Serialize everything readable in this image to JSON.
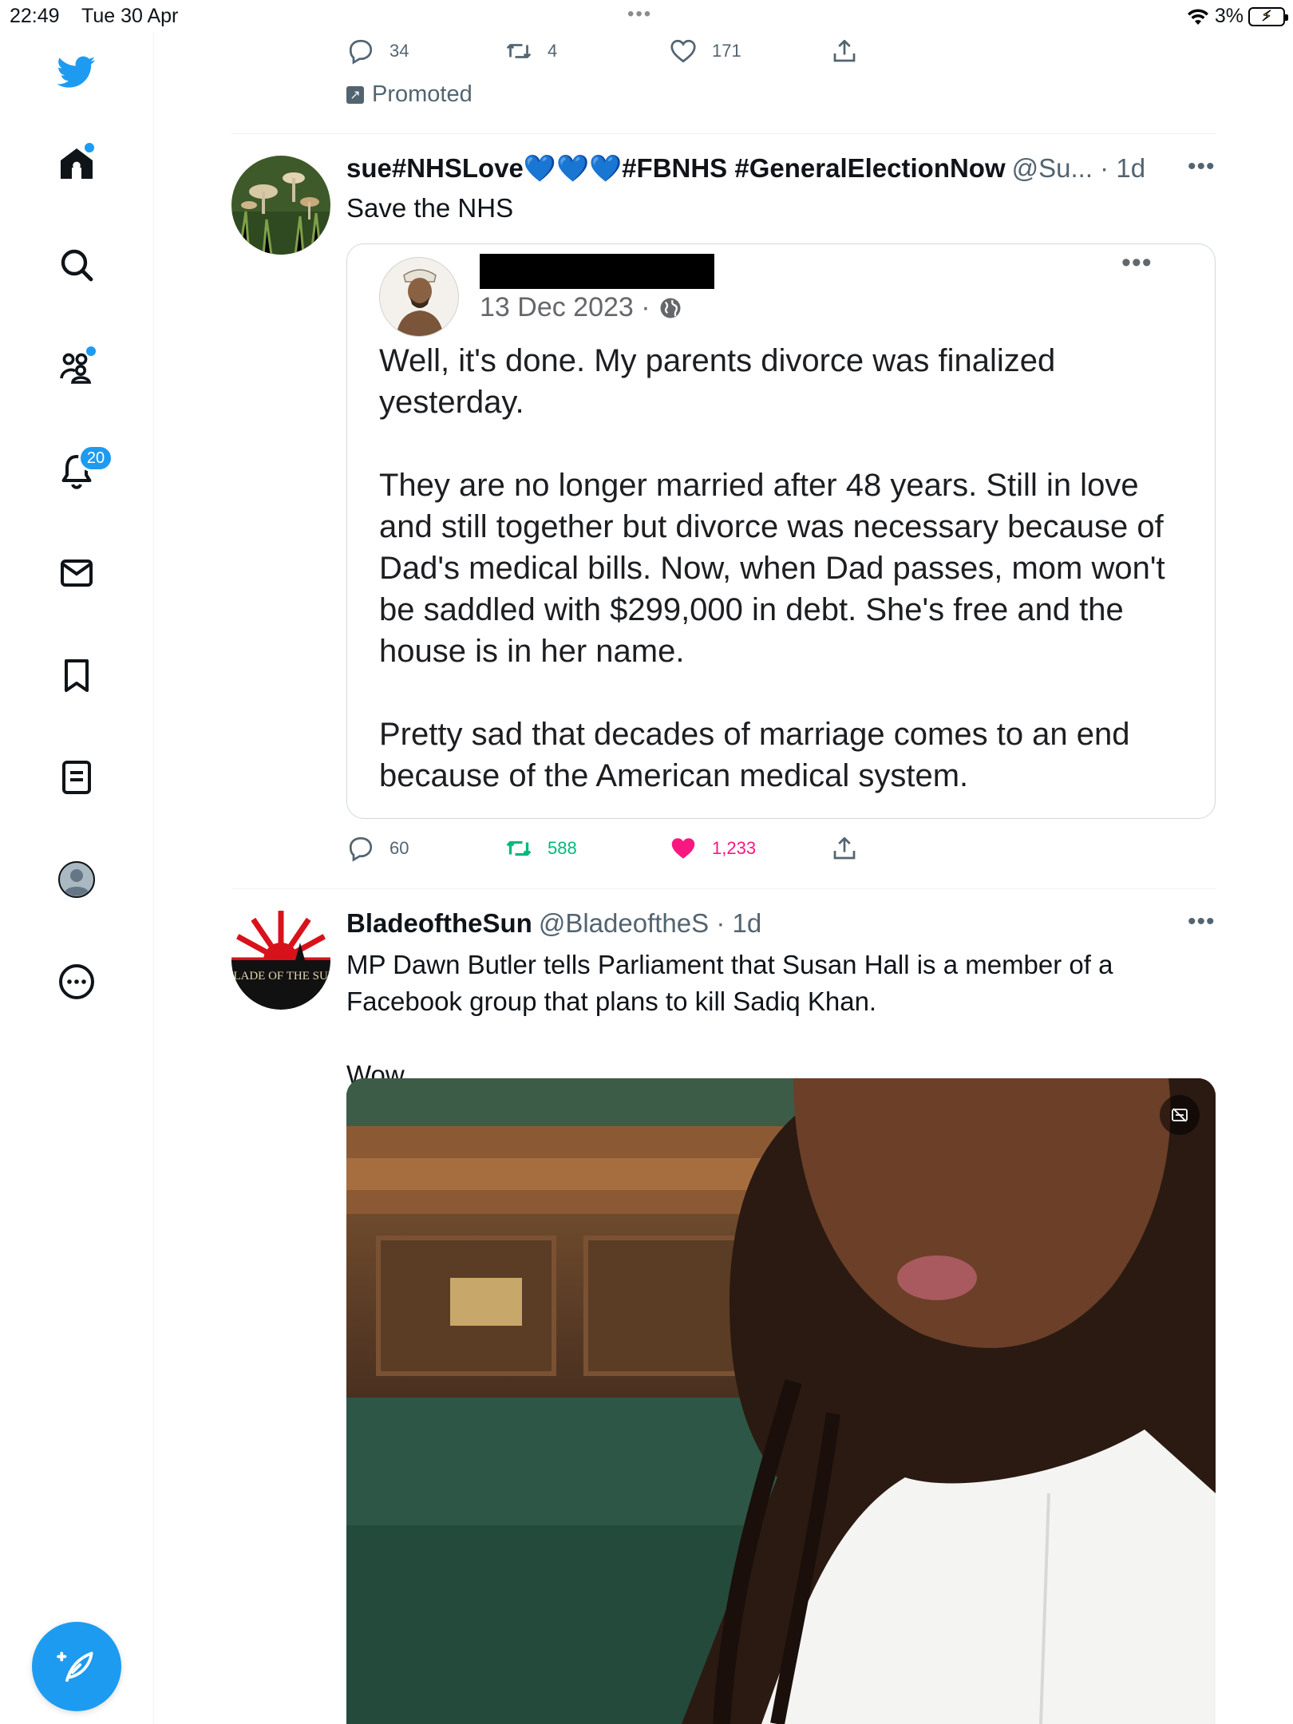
{
  "status_bar": {
    "time": "22:49",
    "date": "Tue 30 Apr",
    "battery_percent": "3%",
    "dots": "•••"
  },
  "sidebar": {
    "notifications_count": "20",
    "items": [
      {
        "name": "logo",
        "icon": "twitter-bird-icon"
      },
      {
        "name": "home",
        "icon": "home-icon",
        "has_dot": true
      },
      {
        "name": "explore",
        "icon": "search-icon"
      },
      {
        "name": "communities",
        "icon": "communities-icon",
        "has_dot": true
      },
      {
        "name": "notifications",
        "icon": "bell-icon"
      },
      {
        "name": "messages",
        "icon": "mail-icon"
      },
      {
        "name": "bookmarks",
        "icon": "bookmark-icon"
      },
      {
        "name": "lists",
        "icon": "list-icon"
      },
      {
        "name": "profile",
        "icon": "profile-avatar-icon"
      },
      {
        "name": "more",
        "icon": "more-circle-icon"
      }
    ],
    "compose_icon": "compose-feather-icon"
  },
  "promoted_tweet": {
    "replies": "34",
    "retweets": "4",
    "likes": "171",
    "promoted_label": "Promoted"
  },
  "tweet1": {
    "display_name": "sue#NHSLove💙💙💙#FBNHS #GeneralElectionNow",
    "handle_time": "@Su... · 1d",
    "text": "Save the NHS",
    "quote": {
      "date": "13 Dec 2023 ·",
      "paragraphs": [
        "Well, it's done. My parents divorce was finalized yesterday.",
        "They are no longer married after 48 years. Still in love and still together but divorce was necessary because of Dad's medical bills. Now, when Dad passes, mom won't be saddled with $299,000 in debt. She's free and the house is in her name.",
        "Pretty sad that decades of marriage comes to an end because of the American medical system."
      ]
    },
    "replies": "60",
    "retweets": "588",
    "likes": "1,233",
    "retweet_color": "#00ba7c",
    "like_color": "#f91880"
  },
  "tweet2": {
    "display_name": "BladeoftheSun",
    "handle_time": "@BladeoftheS · 1d",
    "text": "MP Dawn Butler tells Parliament that Susan Hall is a member of a Facebook group that plans to kill Sadiq Khan.\n\nWow.",
    "avatar_text": "BLADE OF THE SUN"
  },
  "colors": {
    "accent": "#1d9bf0",
    "secondary_text": "#536471",
    "border": "#eff3f4"
  }
}
